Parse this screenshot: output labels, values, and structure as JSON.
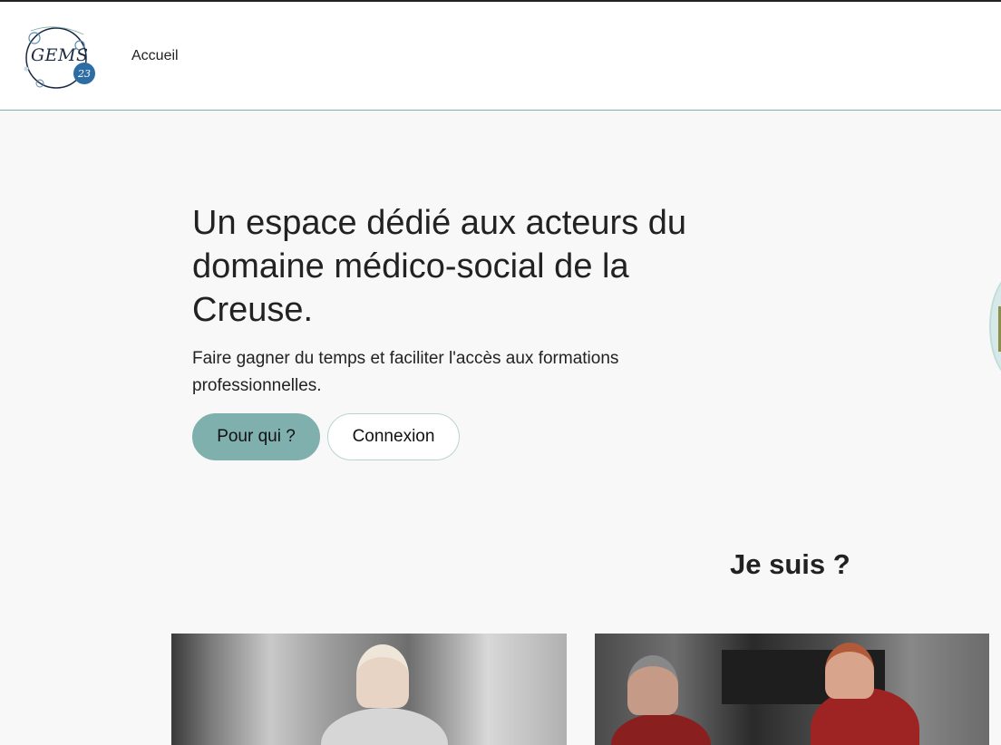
{
  "header": {
    "logo": {
      "main_text": "GEMS",
      "badge_text": "23",
      "icon": "gems23-logo"
    },
    "nav": {
      "home_label": "Accueil"
    }
  },
  "hero": {
    "title": "Un espace dédié aux acteurs du domaine médico-social de la Creuse.",
    "subtitle": "Faire gagner du temps et faciliter l'accès aux formations professionnelles.",
    "primary_button": "Pour qui ?",
    "secondary_button": "Connexion"
  },
  "section": {
    "title": "Je suis ?",
    "cards": [
      {
        "image": "photo-woman-professional"
      },
      {
        "image": "photo-paramedics-ambulance"
      }
    ]
  },
  "colors": {
    "accent": "#7fb0ad",
    "background": "#f8f8f8",
    "text": "#222222"
  }
}
